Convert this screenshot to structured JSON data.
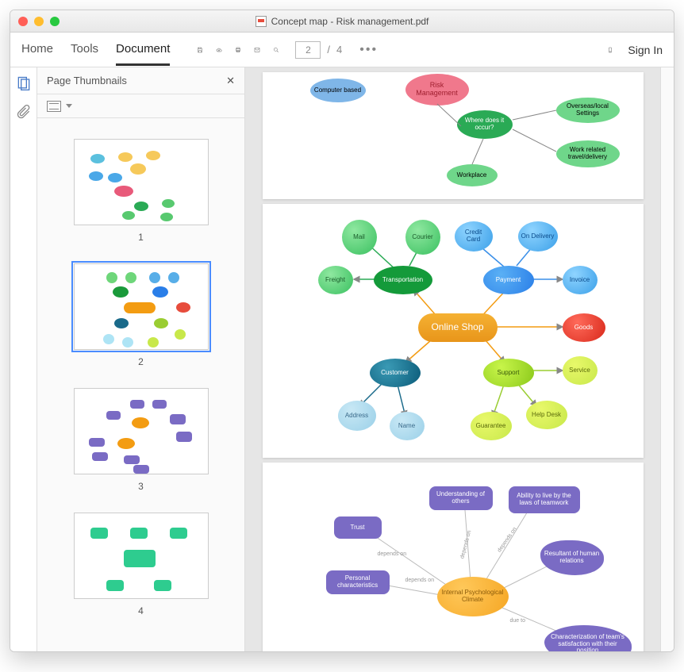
{
  "window": {
    "title": "Concept map - Risk management.pdf"
  },
  "tabs": {
    "home": "Home",
    "tools": "Tools",
    "document": "Document"
  },
  "paging": {
    "current": "2",
    "sep": "/",
    "total": "4"
  },
  "signin": "Sign In",
  "panel": {
    "title": "Page Thumbnails"
  },
  "thumbs": {
    "n1": "1",
    "n2": "2",
    "n3": "3",
    "n4": "4"
  },
  "map1": {
    "computer_based": "Computer based",
    "risk_mgmt": "Risk Management",
    "where": "Where does it occur?",
    "overseas": "Overseas/local Settings",
    "work_related": "Work related travel/delivery",
    "workplace": "Workplace"
  },
  "map2": {
    "mail": "Mail",
    "courier": "Courier",
    "credit": "Credit Card",
    "delivery": "On Delivery",
    "freight": "Freight",
    "transport": "Transportation",
    "payment": "Payment",
    "invoice": "Invoice",
    "online": "Online Shop",
    "goods": "Goods",
    "customer": "Customer",
    "support": "Support",
    "service": "Service",
    "address": "Address",
    "name": "Name",
    "guarantee": "Guarantee",
    "helpdesk": "Help Desk"
  },
  "map3": {
    "understanding": "Understanding of others",
    "ability": "Ability to live by the laws of teamwork",
    "trust": "Trust",
    "resultant": "Resultant of human relations",
    "personal": "Personal characteristics",
    "internal": "Internal Psychological Climate",
    "characterization": "Characterization of team's satisfaction with their position",
    "depends": "depends on",
    "due": "due to"
  }
}
